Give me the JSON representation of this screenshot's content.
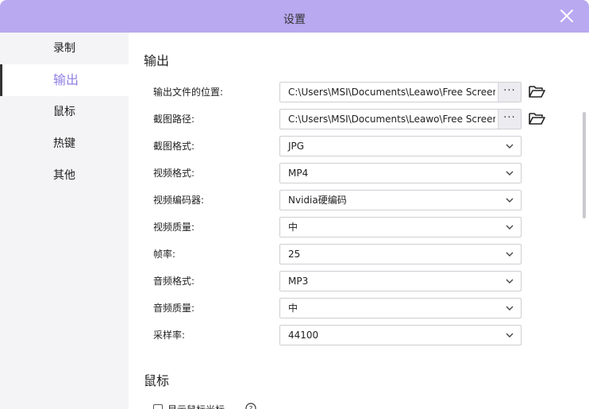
{
  "window": {
    "title": "设置"
  },
  "sidebar": {
    "items": [
      {
        "label": "录制"
      },
      {
        "label": "输出"
      },
      {
        "label": "鼠标"
      },
      {
        "label": "热键"
      },
      {
        "label": "其他"
      }
    ],
    "active_index": 1
  },
  "output": {
    "section_title": "输出",
    "output_path": {
      "label": "输出文件的位置:",
      "value": "C:\\Users\\MSI\\Documents\\Leawo\\Free Screen",
      "more_label": "···"
    },
    "screenshot_path": {
      "label": "截图路径:",
      "value": "C:\\Users\\MSI\\Documents\\Leawo\\Free Screen",
      "more_label": "···"
    },
    "screenshot_format": {
      "label": "截图格式:",
      "value": "JPG"
    },
    "video_format": {
      "label": "视频格式:",
      "value": "MP4"
    },
    "video_encoder": {
      "label": "视频编码器:",
      "value": "Nvidia硬编码"
    },
    "video_quality": {
      "label": "视频质量:",
      "value": "中"
    },
    "frame_rate": {
      "label": "帧率:",
      "value": "25"
    },
    "audio_format": {
      "label": "音频格式:",
      "value": "MP3"
    },
    "audio_quality": {
      "label": "音频质量:",
      "value": "中"
    },
    "sample_rate": {
      "label": "采样率:",
      "value": "44100"
    }
  },
  "mouse": {
    "section_title": "鼠标",
    "show_cursor": {
      "label": "显示鼠标光标",
      "checked": false
    }
  },
  "colors": {
    "titlebar": "#b8a9f0",
    "accent": "#8f80e6",
    "sidebar_bg": "#f4f4f6"
  },
  "icons": {
    "close": "close-icon",
    "folder": "folder-open-icon",
    "chevron": "chevron-down-icon",
    "help": "help-icon"
  }
}
